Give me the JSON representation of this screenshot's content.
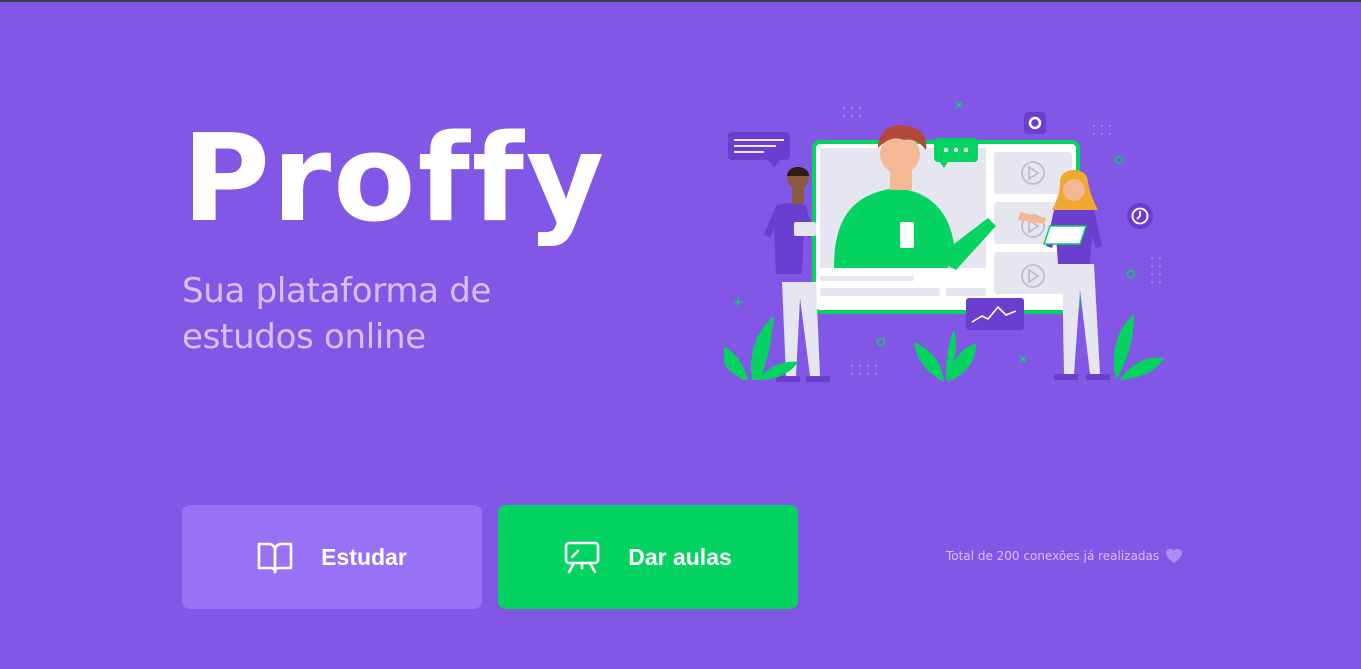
{
  "brand": {
    "logo_text": "Proffy",
    "tagline_line1": "Sua plataforma de",
    "tagline_line2": "estudos online"
  },
  "actions": {
    "study_label": "Estudar",
    "teach_label": "Dar aulas"
  },
  "footer": {
    "connections_text": "Total de 200 conexões já realizadas"
  },
  "icons": {
    "study": "book-open-icon",
    "teach": "presentation-board-icon",
    "connections": "purple-heart-icon"
  },
  "colors": {
    "background": "#8257e5",
    "study_button": "#9871f5",
    "teach_button": "#04d361",
    "tagline": "#d4c2ff",
    "heart": "#a98ef7"
  }
}
